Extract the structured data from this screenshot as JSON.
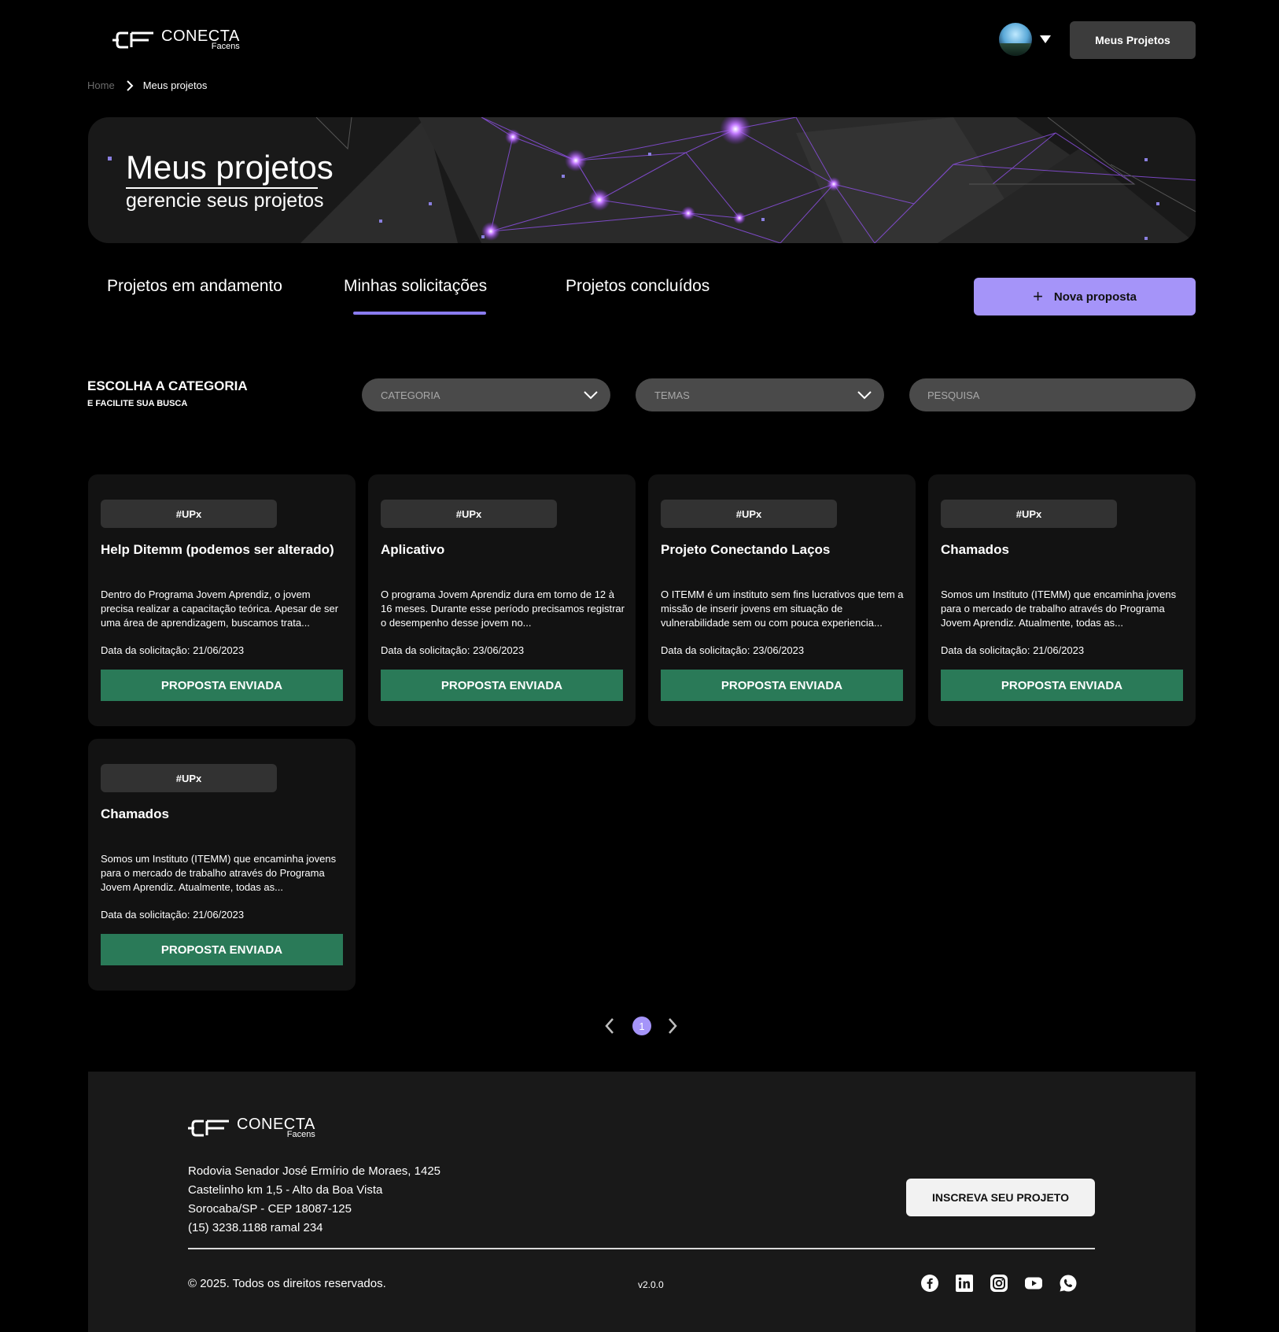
{
  "brand": {
    "name": "CONECTA",
    "sub": "Facens"
  },
  "header": {
    "my_projects_button": "Meus Projetos"
  },
  "breadcrumb": {
    "home": "Home",
    "current": "Meus projetos"
  },
  "hero": {
    "title": "Meus projetos",
    "subtitle": "gerencie seus projetos"
  },
  "tabs": [
    {
      "label": "Projetos em andamento",
      "active": false
    },
    {
      "label": "Minhas solicitações",
      "active": true
    },
    {
      "label": "Projetos concluídos",
      "active": false
    }
  ],
  "new_proposal_button": "Nova proposta",
  "filters": {
    "title": "ESCOLHA A CATEGORIA",
    "subtitle": "E FACILITE SUA BUSCA",
    "category_placeholder": "CATEGORIA",
    "themes_placeholder": "TEMAS",
    "search_placeholder": "PESQUISA"
  },
  "cards": [
    {
      "tag": "#UPx",
      "title": "Help Ditemm (podemos ser alterado)",
      "description": "Dentro do Programa Jovem Aprendiz, o jovem precisa realizar a capacitação teórica. Apesar de ser uma área de aprendizagem, buscamos trata...",
      "date": "Data da solicitação: 21/06/2023",
      "status": "PROPOSTA ENVIADA"
    },
    {
      "tag": "#UPx",
      "title": "Aplicativo",
      "description": "O programa Jovem Aprendiz dura em torno de 12 à 16 meses. Durante esse período precisamos registrar o desempenho desse jovem no...",
      "date": "Data da solicitação: 23/06/2023",
      "status": "PROPOSTA ENVIADA"
    },
    {
      "tag": "#UPx",
      "title": "Projeto Conectando Laços",
      "description": "O ITEMM é um instituto sem fins lucrativos que tem a missão de inserir jovens em situação de vulnerabilidade sem ou com pouca experiencia...",
      "date": "Data da solicitação: 23/06/2023",
      "status": "PROPOSTA ENVIADA"
    },
    {
      "tag": "#UPx",
      "title": "Chamados",
      "description": "Somos um Instituto (ITEMM) que encaminha jovens para o mercado de trabalho através do Programa Jovem Aprendiz. Atualmente, todas as...",
      "date": "Data da solicitação: 21/06/2023",
      "status": "PROPOSTA ENVIADA"
    },
    {
      "tag": "#UPx",
      "title": "Chamados",
      "description": "Somos um Instituto (ITEMM) que encaminha jovens para o mercado de trabalho através do Programa Jovem Aprendiz. Atualmente, todas as...",
      "date": "Data da solicitação: 21/06/2023",
      "status": "PROPOSTA ENVIADA"
    }
  ],
  "pagination": {
    "current": "1"
  },
  "footer": {
    "address_lines": [
      "Rodovia Senador José Ermírio de Moraes, 1425",
      "Castelinho km 1,5 - Alto da Boa Vista",
      "Sorocaba/SP - CEP 18087-125",
      "(15) 3238.1188 ramal 234"
    ],
    "subscribe_button": "INSCREVA SEU PROJETO",
    "copyright": "© 2025. Todos os direitos reservados.",
    "version": "v2.0.0",
    "socials": [
      "facebook-icon",
      "linkedin-icon",
      "instagram-icon",
      "youtube-icon",
      "whatsapp-icon"
    ]
  },
  "colors": {
    "accent": "#a594f9",
    "status_green": "#2a7a58",
    "card_bg": "#121212",
    "footer_bg": "#191919"
  }
}
